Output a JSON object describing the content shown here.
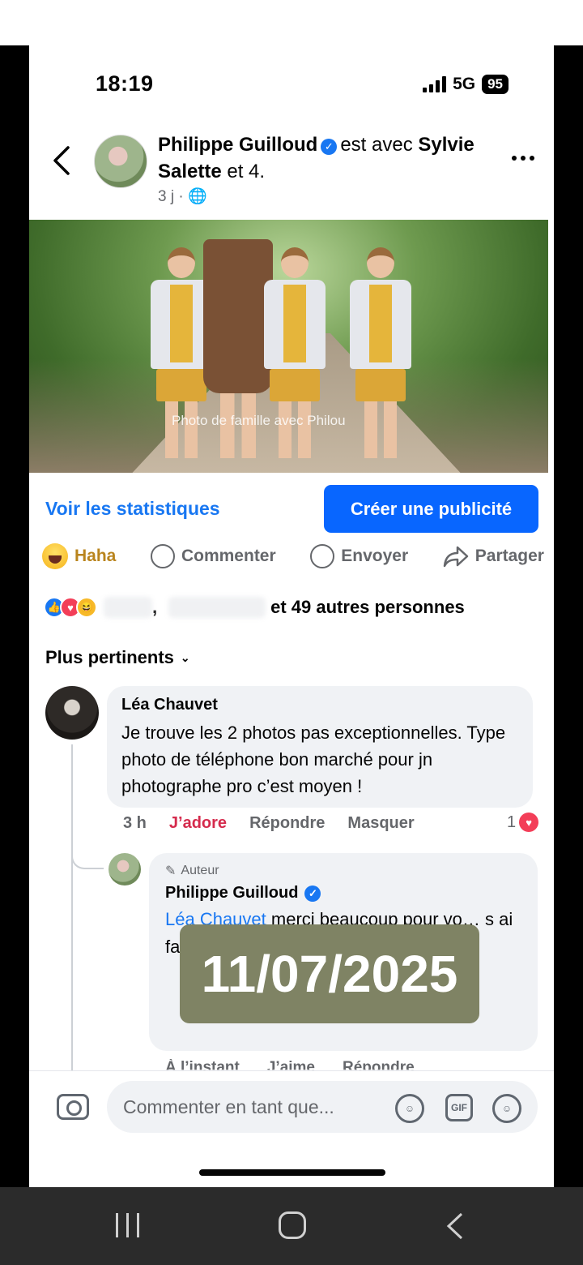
{
  "status": {
    "time": "18:19",
    "network": "5G",
    "battery": "95"
  },
  "post": {
    "author": "Philippe Guilloud",
    "with_text": "est avec",
    "tagged": "Sylvie Salette",
    "others": "et 4.",
    "meta": "3 j ·",
    "photo_caption": "Photo de famille avec Philou"
  },
  "actions": {
    "stats_link": "Voir les statistiques",
    "ad_button": "Créer une publicité",
    "reaction_label": "Haha",
    "comment_label": "Commenter",
    "send_label": "Envoyer",
    "share_label": "Partager"
  },
  "likes": {
    "separator": ",",
    "summary": "et 49 autres personnes"
  },
  "sort_label": "Plus pertinents",
  "comments": [
    {
      "author": "Léa Chauvet",
      "text": "Je trouve les 2 photos pas exceptionnelles. Type photo de téléphone bon marché pour jn photographe pro c’est moyen !",
      "time": "3 h",
      "reaction": "J’adore",
      "reply": "Répondre",
      "hide": "Masquer",
      "reaction_count": "1"
    },
    {
      "author_tag": "Auteur",
      "author": "Philippe Guilloud",
      "mention": "Léa Chauvet",
      "text_visible": "merci beaucoup pour vo… s ai fa… to… en je suis nul 🤗",
      "time": "À l’instant",
      "like": "J’aime",
      "reply": "Répondre"
    }
  ],
  "date_overlay": "11/07/2025",
  "composer": {
    "placeholder": "Commenter en tant que...",
    "gif_label": "GIF"
  },
  "icons": [
    "back-chevron-icon",
    "verified-badge-icon",
    "globe-icon",
    "more-icon",
    "haha-emoji-icon",
    "comment-bubble-icon",
    "messenger-icon",
    "share-arrow-icon",
    "camera-icon",
    "avatar-sticker-icon",
    "gif-icon",
    "smiley-icon"
  ],
  "colors": {
    "accent": "#1877f2",
    "button": "#0866ff",
    "love": "#f33e58",
    "overlay": "#7f8364"
  }
}
